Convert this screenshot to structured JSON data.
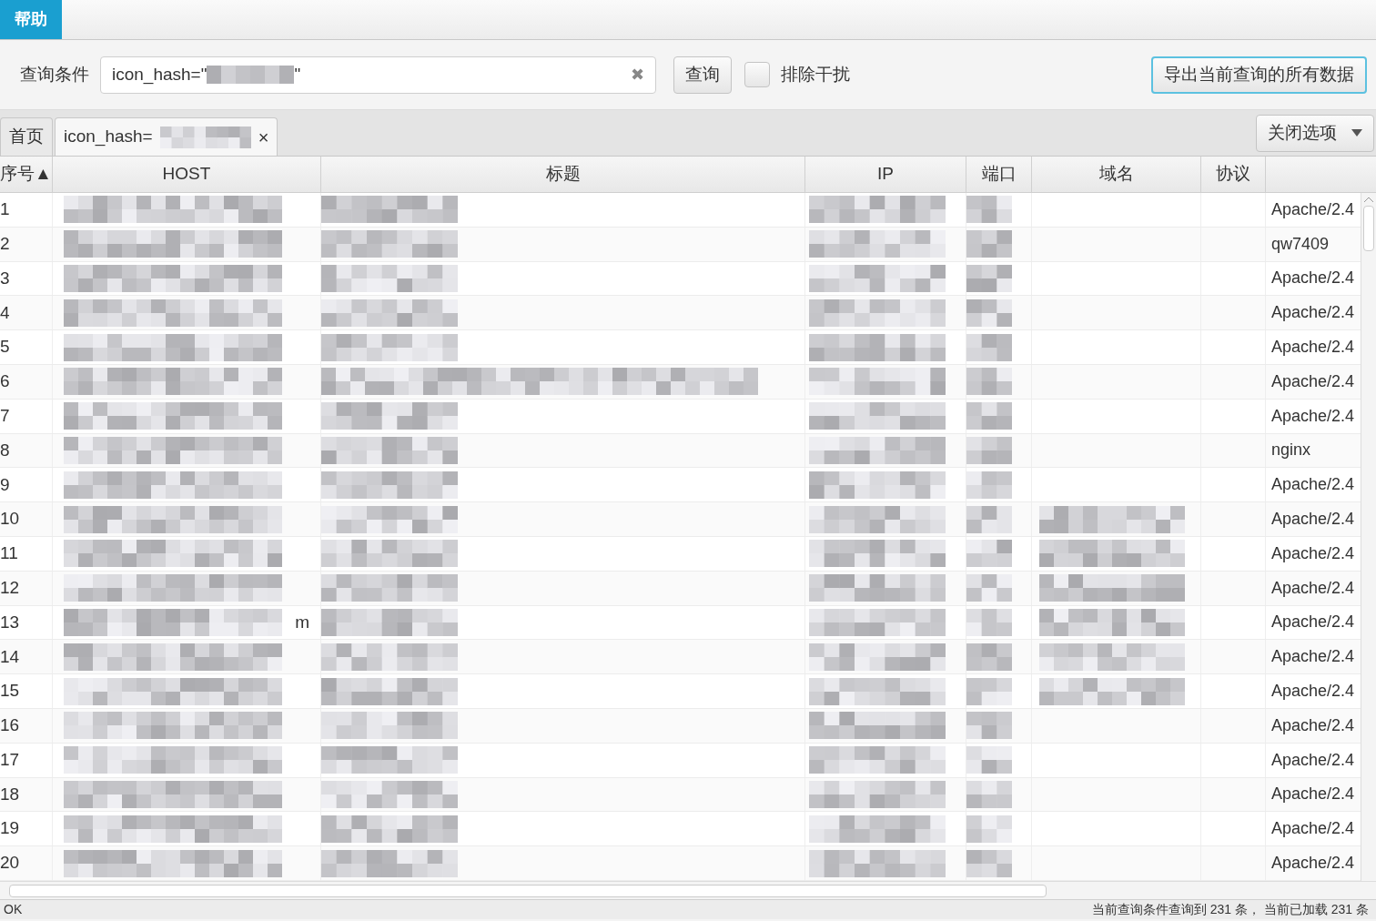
{
  "menu": [
    {
      "label": "帮助",
      "selected": true
    }
  ],
  "query": {
    "label": "查询条件",
    "value_prefix": "icon_hash=\"",
    "value_suffix": "\"",
    "clear": "✖",
    "search_button": "查询",
    "exclude": {
      "label": "排除干扰",
      "checked": false
    },
    "export_button": "导出当前查询的所有数据"
  },
  "tabs": [
    {
      "label": "首页",
      "selected": false
    },
    {
      "label": "icon_hash=",
      "selected": true,
      "close": "×"
    }
  ],
  "close_options": "关闭选项",
  "table": {
    "columns": [
      {
        "label": "序号",
        "sort_mark": "▲"
      },
      {
        "label": "HOST"
      },
      {
        "label": "标题"
      },
      {
        "label": "IP"
      },
      {
        "label": "端口"
      },
      {
        "label": "域名"
      },
      {
        "label": "协议"
      }
    ],
    "rows": [
      {
        "index": "1",
        "domain_blurred": false,
        "column_8": "Apache/2.4"
      },
      {
        "index": "2",
        "domain_blurred": false,
        "column_8": "qw7409"
      },
      {
        "index": "3",
        "domain_blurred": false,
        "column_8": "Apache/2.4"
      },
      {
        "index": "4",
        "domain_blurred": false,
        "column_8": "Apache/2.4"
      },
      {
        "index": "5",
        "domain_blurred": false,
        "column_8": "Apache/2.4"
      },
      {
        "index": "6",
        "domain_blurred": false,
        "column_8": "Apache/2.4"
      },
      {
        "index": "7",
        "domain_blurred": false,
        "column_8": "Apache/2.4"
      },
      {
        "index": "8",
        "domain_blurred": false,
        "column_8": "nginx"
      },
      {
        "index": "9",
        "domain_blurred": false,
        "column_8": "Apache/2.4"
      },
      {
        "index": "10",
        "domain_blurred": true,
        "column_8": "Apache/2.4"
      },
      {
        "index": "11",
        "domain_blurred": true,
        "column_8": "Apache/2.4"
      },
      {
        "index": "12",
        "domain_blurred": true,
        "column_8": "Apache/2.4"
      },
      {
        "index": "13",
        "host_tail": "m",
        "domain_blurred": true,
        "column_8": "Apache/2.4"
      },
      {
        "index": "14",
        "domain_blurred": true,
        "column_8": "Apache/2.4"
      },
      {
        "index": "15",
        "domain_blurred": true,
        "column_8": "Apache/2.4"
      },
      {
        "index": "16",
        "domain_blurred": false,
        "column_8": "Apache/2.4"
      },
      {
        "index": "17",
        "domain_blurred": false,
        "column_8": "Apache/2.4"
      },
      {
        "index": "18",
        "domain_blurred": false,
        "column_8": "Apache/2.4"
      },
      {
        "index": "19",
        "domain_blurred": false,
        "column_8": "Apache/2.4"
      },
      {
        "index": "20",
        "domain_blurred": false,
        "column_8": "Apache/2.4"
      }
    ]
  },
  "status_bar": {
    "left": "OK",
    "right": "当前查询条件查询到 231 条， 当前已加载 231 条"
  }
}
